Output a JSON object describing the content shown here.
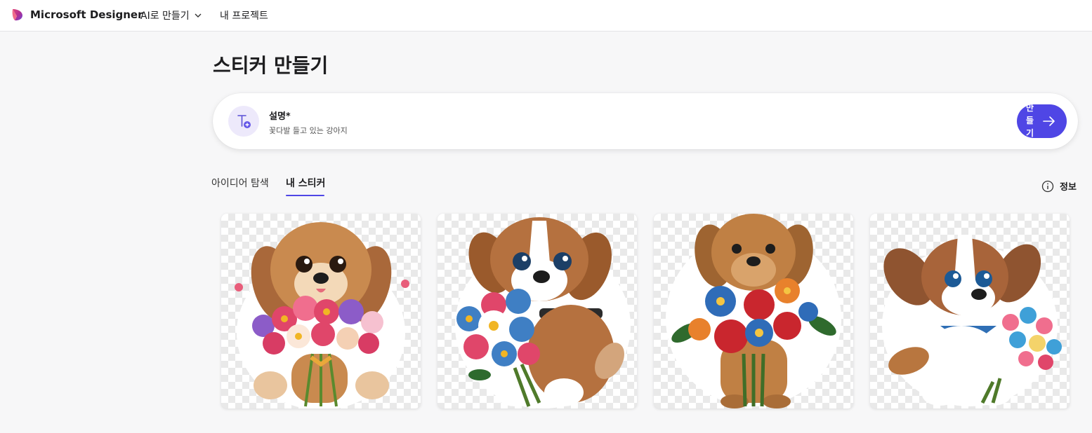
{
  "header": {
    "brand": "Microsoft Designer",
    "nav_ai": "AI로 만들기",
    "nav_projects": "내 프로젝트"
  },
  "page": {
    "title": "스티커 만들기"
  },
  "prompt": {
    "label": "설명*",
    "value": "꽃다발 들고 있는 강아지",
    "create_label": "만들기"
  },
  "tabs": [
    {
      "label": "아이디어 탐색",
      "active": false
    },
    {
      "label": "내 스티커",
      "active": true
    }
  ],
  "info_label": "정보",
  "stickers": [
    {
      "subject": "puppy-with-bouquet",
      "fur": "#c98a4f",
      "muzzle": "#f3d9b8"
    },
    {
      "subject": "puppy-with-bouquet",
      "fur": "#b5713f",
      "muzzle": "#ffffff"
    },
    {
      "subject": "puppy-with-bouquet",
      "fur": "#c08044",
      "muzzle": "#d9a36b"
    },
    {
      "subject": "puppy-with-bouquet",
      "fur": "#a8643a",
      "muzzle": "#ffffff"
    }
  ],
  "colors": {
    "accent": "#4f46e5",
    "icon_bg": "#ede9fb",
    "background": "#f7f7f8"
  }
}
